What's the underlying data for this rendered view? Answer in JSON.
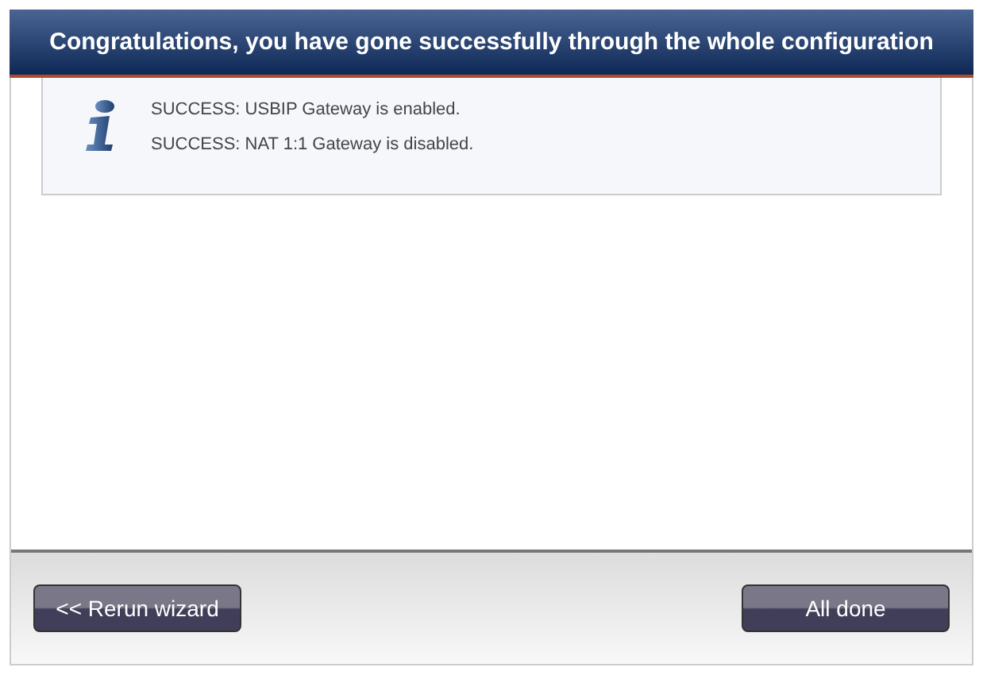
{
  "dialog": {
    "title": "Congratulations, you have gone successfully through the whole configuration"
  },
  "messages": [
    "SUCCESS: USBIP Gateway is enabled.",
    "SUCCESS: NAT 1:1 Gateway is disabled."
  ],
  "buttons": [
    {
      "label": "<< Rerun wizard"
    },
    {
      "label": "All done"
    }
  ]
}
